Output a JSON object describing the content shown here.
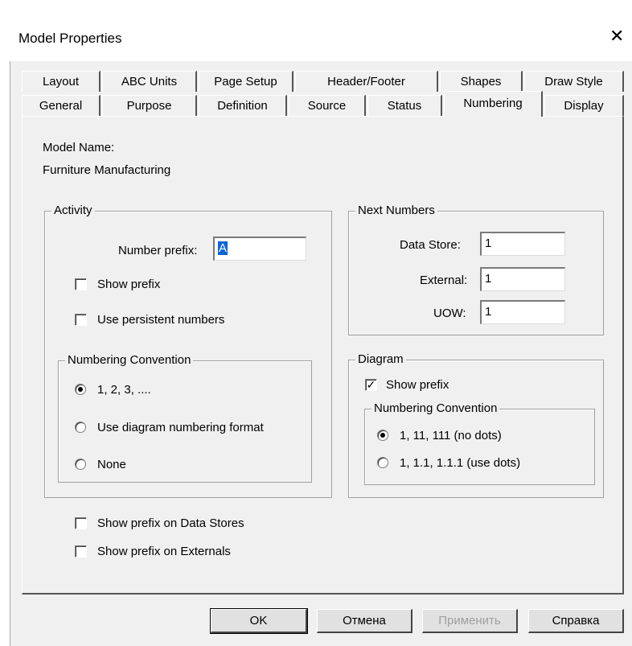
{
  "window": {
    "title": "Model Properties",
    "close_glyph": "✕"
  },
  "tabs_row1": [
    "Layout",
    "ABC Units",
    "Page Setup",
    "Header/Footer",
    "Shapes",
    "Draw Style"
  ],
  "tabs_row2": [
    "General",
    "Purpose",
    "Definition",
    "Source",
    "Status",
    "Numbering",
    "Display"
  ],
  "active_tab": "Numbering",
  "model": {
    "name_label": "Model Name:",
    "name_value": "Furniture Manufacturing"
  },
  "activity": {
    "legend": "Activity",
    "prefix_label": "Number prefix:",
    "prefix_value": "A",
    "show_prefix": {
      "label": "Show prefix",
      "checked": false
    },
    "persistent": {
      "label": "Use persistent numbers",
      "checked": false
    },
    "convention": {
      "legend": "Numbering Convention",
      "options": [
        "1, 2, 3, ....",
        "Use diagram numbering format",
        "None"
      ],
      "selected": 0
    }
  },
  "next_numbers": {
    "legend": "Next Numbers",
    "data_store_label": "Data Store:",
    "data_store_value": "1",
    "external_label": "External:",
    "external_value": "1",
    "uow_label": "UOW:",
    "uow_value": "1"
  },
  "diagram": {
    "legend": "Diagram",
    "show_prefix": {
      "label": "Show prefix",
      "checked": true,
      "mark": "✓"
    },
    "convention": {
      "legend": "Numbering Convention",
      "options": [
        "1, 11, 111 (no dots)",
        "1, 1.1, 1.1.1 (use dots)"
      ],
      "selected": 0
    }
  },
  "bottom": {
    "prefix_data_stores": {
      "label": "Show prefix on Data Stores",
      "checked": false
    },
    "prefix_externals": {
      "label": "Show prefix on Externals",
      "checked": false
    }
  },
  "buttons": {
    "ok": "OK",
    "cancel": "Отмена",
    "apply": "Применить",
    "help": "Справка"
  }
}
